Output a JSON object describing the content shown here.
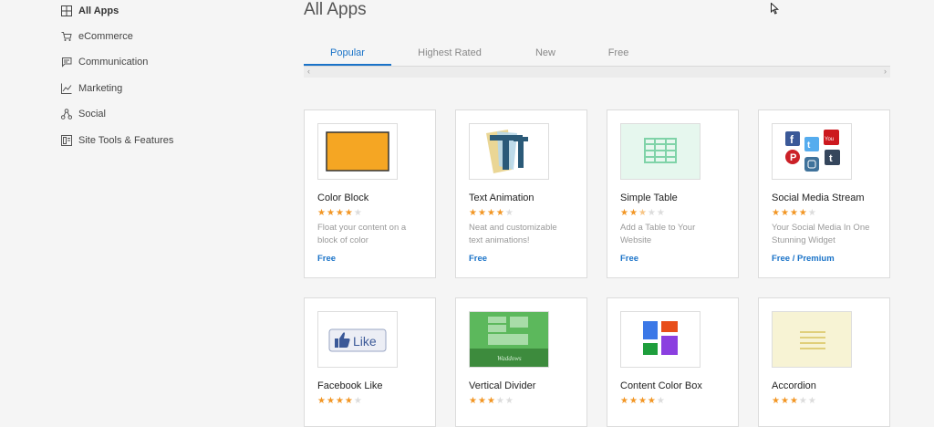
{
  "sidebar": {
    "items": [
      {
        "label": "All Apps",
        "icon": "grid-icon",
        "active": true
      },
      {
        "label": "eCommerce",
        "icon": "cart-icon"
      },
      {
        "label": "Communication",
        "icon": "chat-icon"
      },
      {
        "label": "Marketing",
        "icon": "chart-icon"
      },
      {
        "label": "Social",
        "icon": "share-icon"
      },
      {
        "label": "Site Tools & Features",
        "icon": "tools-icon"
      }
    ]
  },
  "main": {
    "title": "All Apps",
    "tabs": [
      {
        "label": "Popular",
        "active": true
      },
      {
        "label": "Highest Rated"
      },
      {
        "label": "New"
      },
      {
        "label": "Free"
      }
    ],
    "scroll_left": "‹",
    "scroll_right": "›"
  },
  "apps": [
    {
      "title": "Color Block",
      "rating": 4,
      "desc": "Float your content on a block of color",
      "price": "Free",
      "accent": "#f5a623"
    },
    {
      "title": "Text Animation",
      "rating": 4,
      "desc": "Neat and customizable text animations!",
      "price": "Free",
      "accent": "#2b5a78"
    },
    {
      "title": "Simple Table",
      "rating": 2.5,
      "desc": "Add a Table to Your Website",
      "price": "Free",
      "accent": "#7fd3a8"
    },
    {
      "title": "Social Media Stream",
      "rating": 4,
      "desc": "Your Social Media In One Stunning Widget",
      "price": "Free / Premium",
      "accent": "#3b5998"
    },
    {
      "title": "Facebook Like",
      "rating": 4,
      "thumb_text": "Like",
      "accent": "#3b5998"
    },
    {
      "title": "Vertical Divider",
      "rating": 3,
      "thumb_text": "Waddows",
      "accent": "#4caf50"
    },
    {
      "title": "Content Color Box",
      "rating": 4,
      "accent": "#e84e1b"
    },
    {
      "title": "Accordion",
      "rating": 3,
      "accent": "#e8d98a"
    }
  ]
}
